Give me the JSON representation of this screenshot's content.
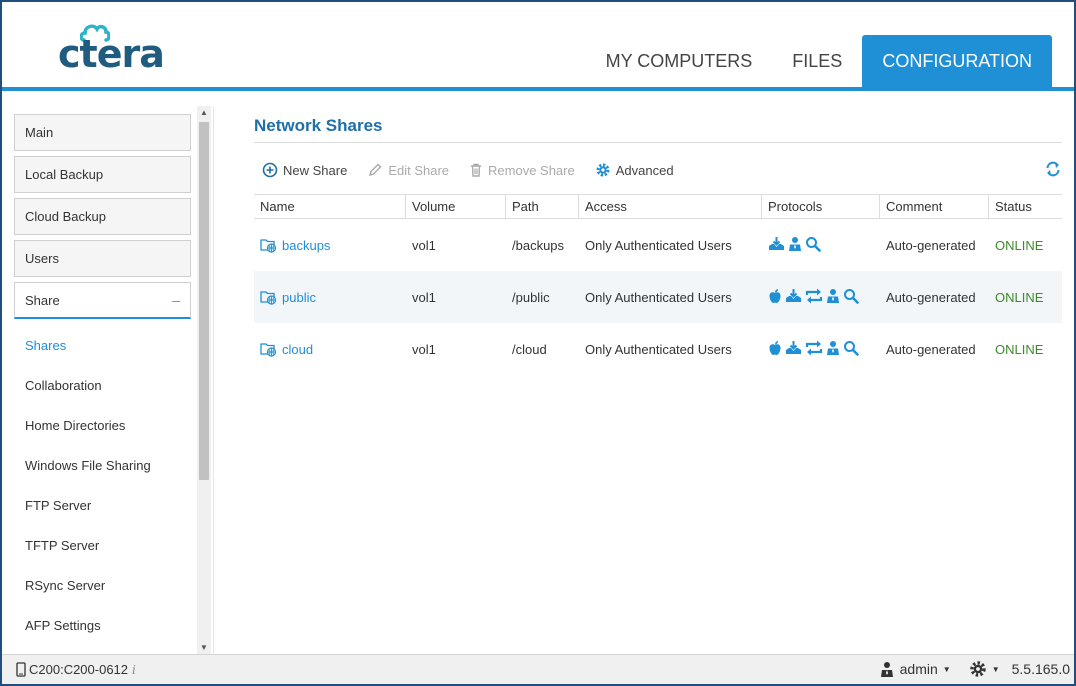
{
  "header": {
    "logo_text": "ctera",
    "tabs": [
      {
        "label": "MY COMPUTERS"
      },
      {
        "label": "FILES"
      },
      {
        "label": "CONFIGURATION"
      }
    ]
  },
  "sidebar": {
    "sections": [
      {
        "label": "Main"
      },
      {
        "label": "Local Backup"
      },
      {
        "label": "Cloud Backup"
      },
      {
        "label": "Users"
      },
      {
        "label": "Share",
        "toggle": "–"
      }
    ],
    "links": [
      {
        "label": "Shares"
      },
      {
        "label": "Collaboration"
      },
      {
        "label": "Home Directories"
      },
      {
        "label": "Windows File Sharing"
      },
      {
        "label": "FTP Server"
      },
      {
        "label": "TFTP Server"
      },
      {
        "label": "RSync Server"
      },
      {
        "label": "AFP Settings"
      }
    ]
  },
  "main": {
    "title": "Network Shares",
    "toolbar": {
      "new_share": "New Share",
      "edit_share": "Edit Share",
      "remove_share": "Remove Share",
      "advanced": "Advanced"
    },
    "columns": [
      "Name",
      "Volume",
      "Path",
      "Access",
      "Protocols",
      "Comment",
      "Status"
    ],
    "rows": [
      {
        "name": "backups",
        "volume": "vol1",
        "path": "/backups",
        "access": "Only Authenticated Users",
        "protocols": [
          "download-icon",
          "user-icon",
          "search-icon"
        ],
        "comment": "Auto-generated",
        "status": "ONLINE"
      },
      {
        "name": "public",
        "volume": "vol1",
        "path": "/public",
        "access": "Only Authenticated Users",
        "protocols": [
          "apple-icon",
          "download-icon",
          "sync-icon",
          "user-icon",
          "search-icon"
        ],
        "comment": "Auto-generated",
        "status": "ONLINE"
      },
      {
        "name": "cloud",
        "volume": "vol1",
        "path": "/cloud",
        "access": "Only Authenticated Users",
        "protocols": [
          "apple-icon",
          "download-icon",
          "sync-icon",
          "user-icon",
          "search-icon"
        ],
        "comment": "Auto-generated",
        "status": "ONLINE"
      }
    ]
  },
  "footer": {
    "device": "C200:C200-0612",
    "info": "i",
    "user": "admin",
    "version": "5.5.165.0"
  },
  "colors": {
    "accent": "#1f8fd6",
    "online": "#3d8a2b",
    "title": "#1f6fa8"
  }
}
